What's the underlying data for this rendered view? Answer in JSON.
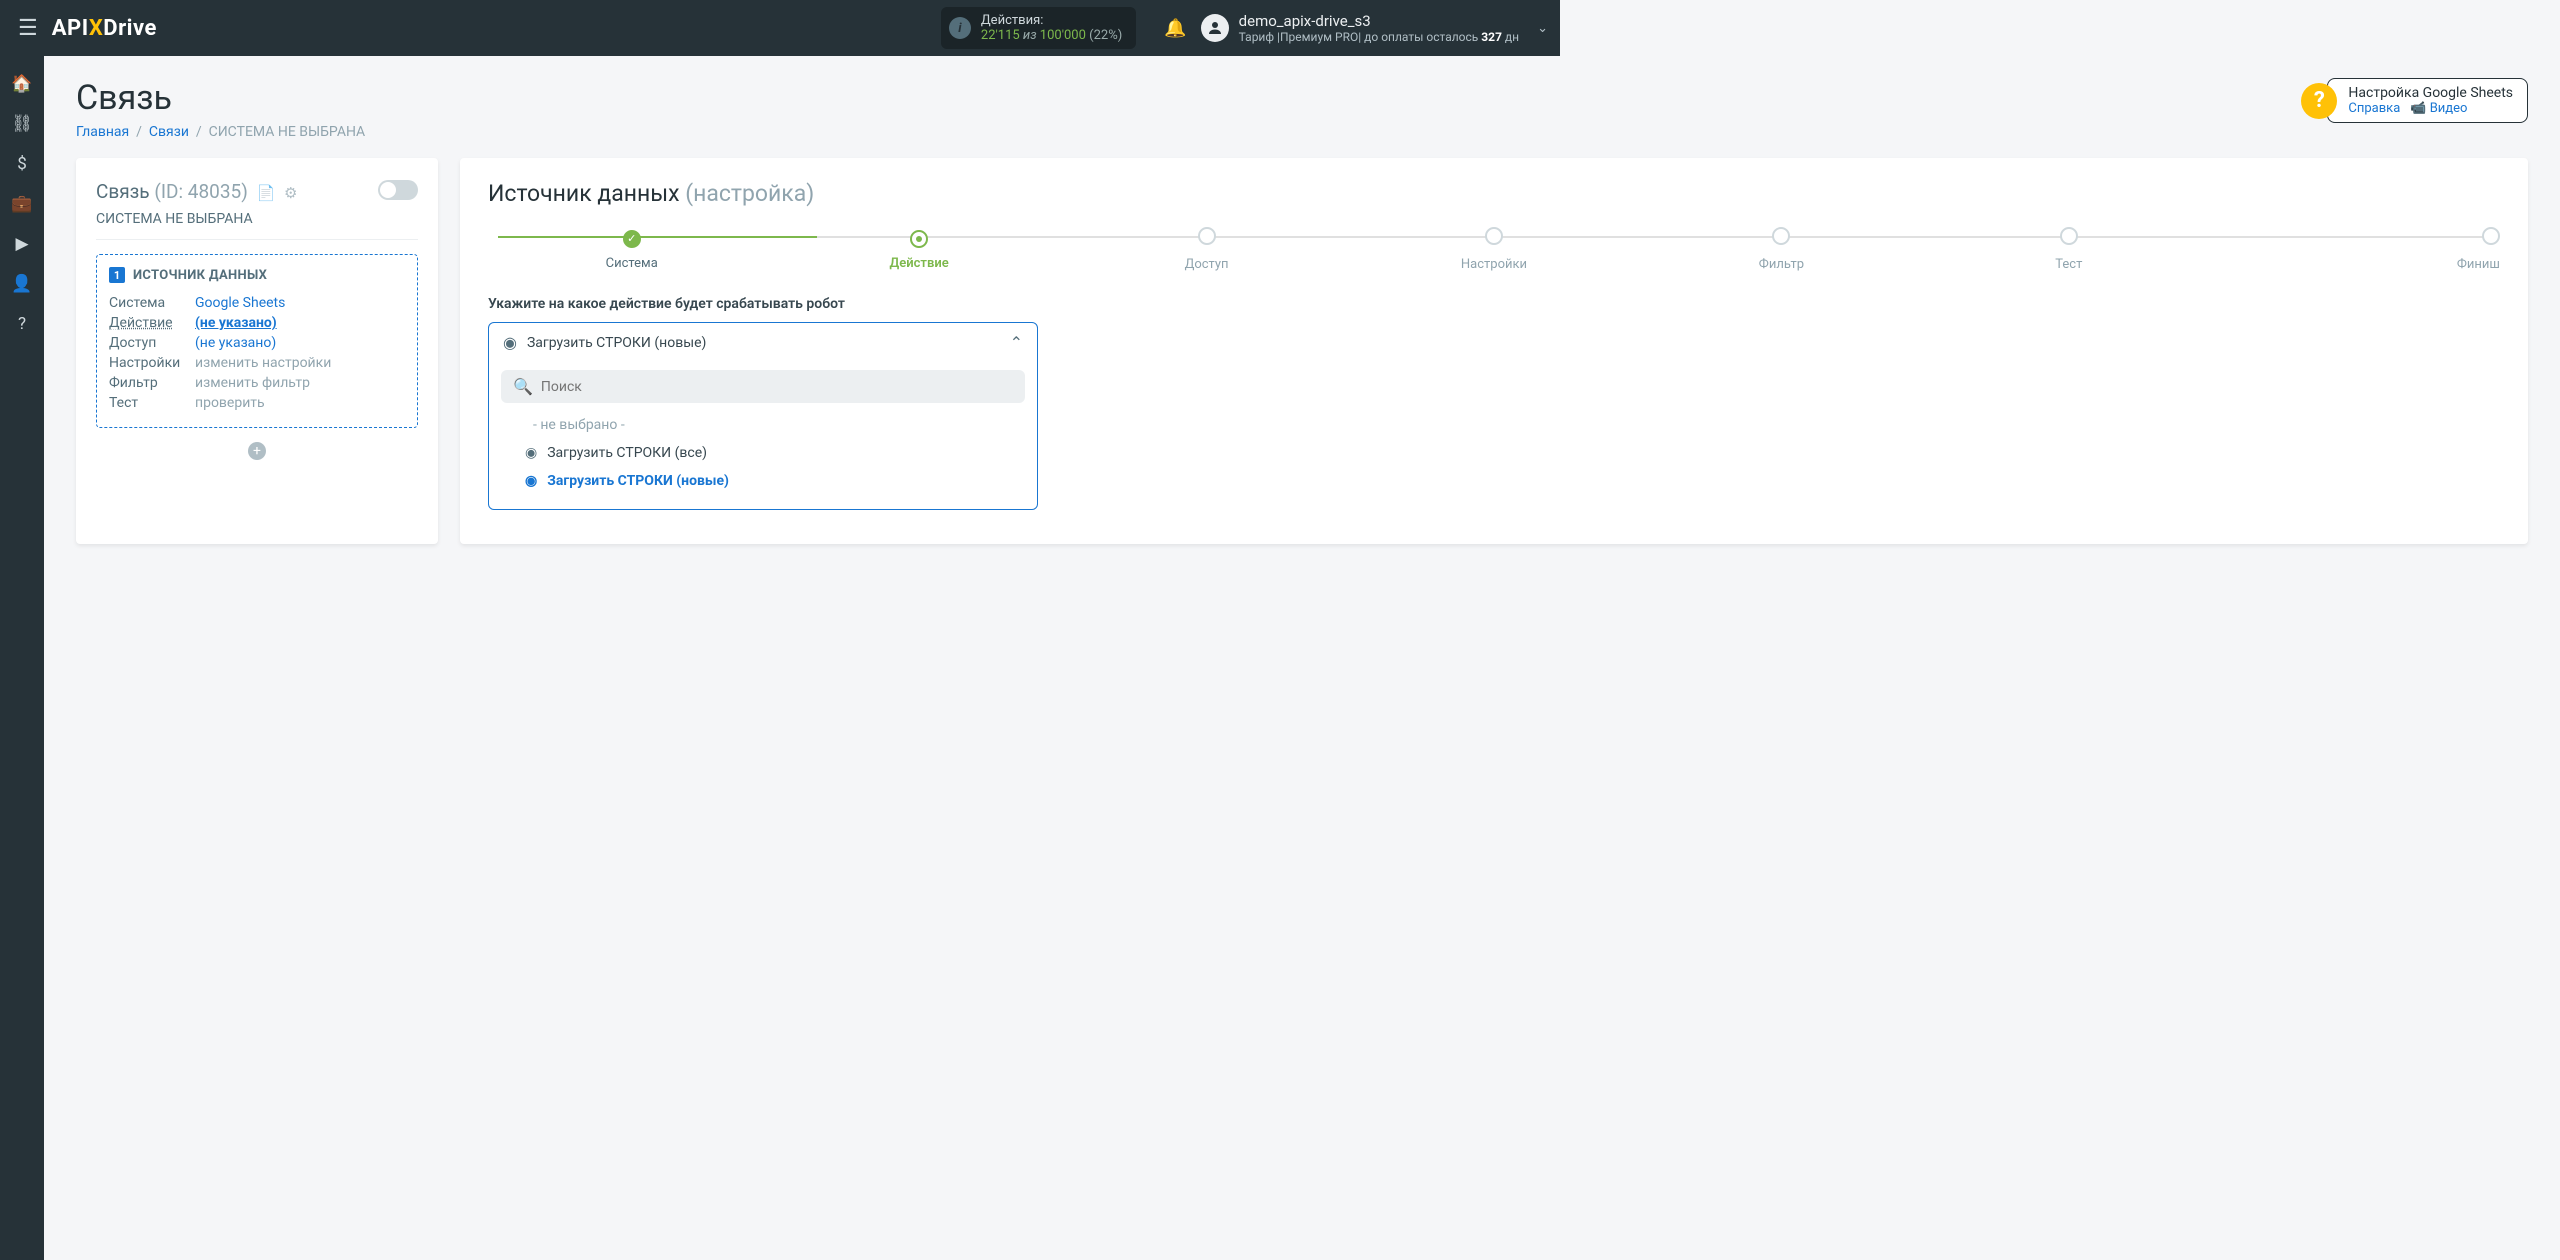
{
  "header": {
    "logo_api": "API",
    "logo_x": "X",
    "logo_drive": "Drive",
    "actions_label": "Действия:",
    "actions_used": "22'115",
    "actions_of": " из ",
    "actions_total": "100'000",
    "actions_percent": "(22%)",
    "user_name": "demo_apix-drive_s3",
    "user_plan": "Тариф |Премиум PRO| до оплаты осталось ",
    "user_days": "327",
    "user_days_suffix": " дн"
  },
  "page": {
    "title": "Связь",
    "bc_home": "Главная",
    "bc_links": "Связи",
    "bc_current": "СИСТЕМА НЕ ВЫБРАНА"
  },
  "left": {
    "title": "Связь",
    "id_label": "(ID: 48035)",
    "sub": "СИСТЕМА НЕ ВЫБРАНА",
    "src_title": "ИСТОЧНИК ДАННЫХ",
    "k_system": "Система",
    "v_system": "Google Sheets",
    "k_action": "Действие",
    "v_action": "(не указано)",
    "k_access": "Доступ",
    "v_access": "(не указано)",
    "k_settings": "Настройки",
    "v_settings": "изменить настройки",
    "k_filter": "Фильтр",
    "v_filter": "изменить фильтр",
    "k_test": "Тест",
    "v_test": "проверить"
  },
  "right": {
    "title_main": "Источник данных",
    "title_dim": "(настройка)",
    "steps": [
      "Система",
      "Действие",
      "Доступ",
      "Настройки",
      "Фильтр",
      "Тест",
      "Финиш"
    ],
    "prompt": "Укажите на какое действие будет срабатывать робот",
    "dd_selected": "Загрузить СТРОКИ (новые)",
    "search_placeholder": "Поиск",
    "opt_none": "- не выбрано -",
    "opt_all": "Загрузить СТРОКИ (все)",
    "opt_new": "Загрузить СТРОКИ (новые)"
  },
  "help": {
    "title": "Настройка Google Sheets",
    "link_doc": "Справка",
    "link_video": "Видео"
  }
}
